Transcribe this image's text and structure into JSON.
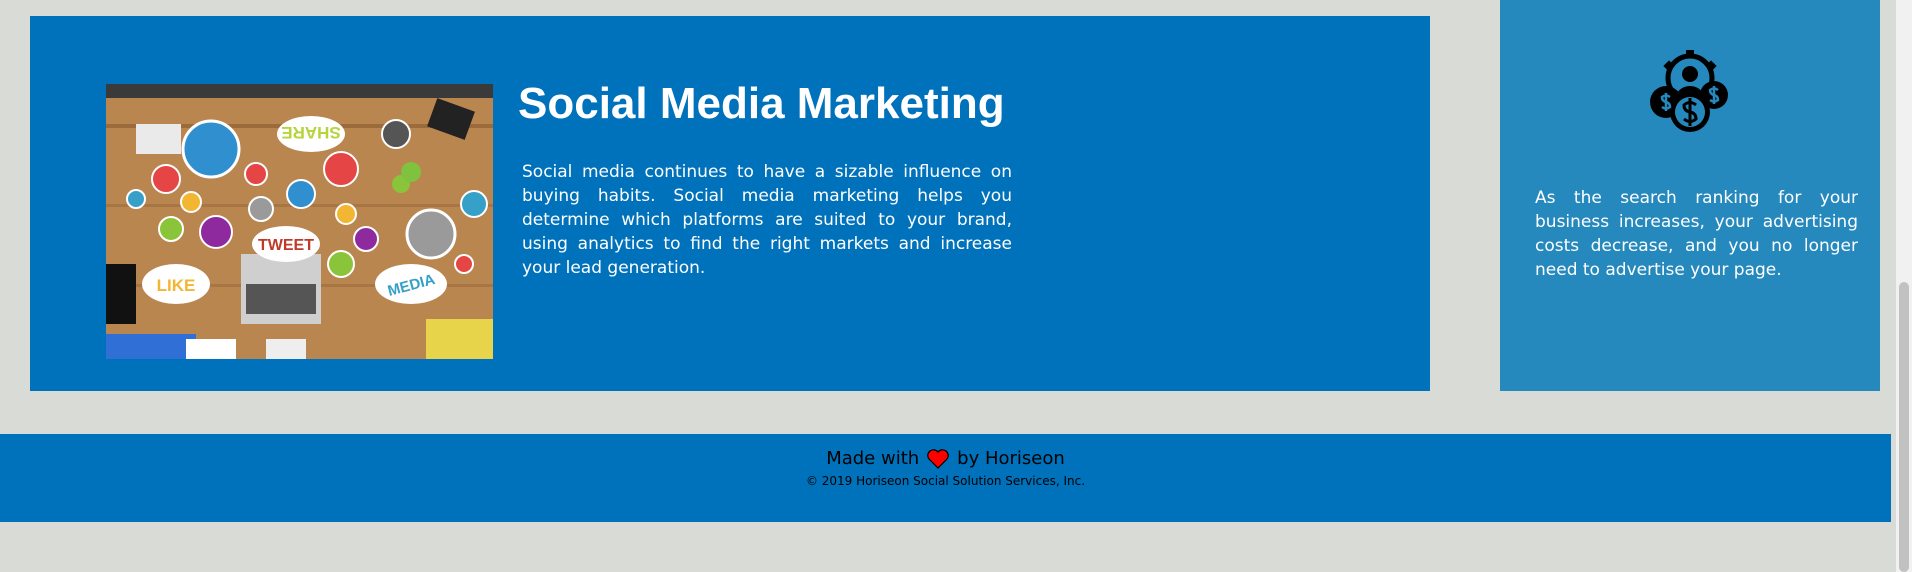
{
  "card": {
    "title": "Social Media Marketing",
    "text": "Social media continues to have a sizable influence on buying habits. Social media marketing helps you determine which platforms are suited to your brand, using analytics to find the right markets and increase your lead generation.",
    "image_bubbles": [
      "SHARE",
      "TWEET",
      "LIKE",
      "MEDIA"
    ]
  },
  "aside": {
    "icon": "cost-management-icon",
    "text": "As the search ranking for your business increases, your advertising costs decrease, and you no longer need to advertise your page."
  },
  "footer": {
    "made_prefix": "Made with",
    "made_suffix": "by Horiseon",
    "copyright": "© 2019 Horiseon Social Solution Services, Inc."
  },
  "colors": {
    "primary_blue": "#0072bb",
    "aside_blue": "#2589bd",
    "page_background": "#d9dbd7",
    "heart": "#ff0000"
  }
}
